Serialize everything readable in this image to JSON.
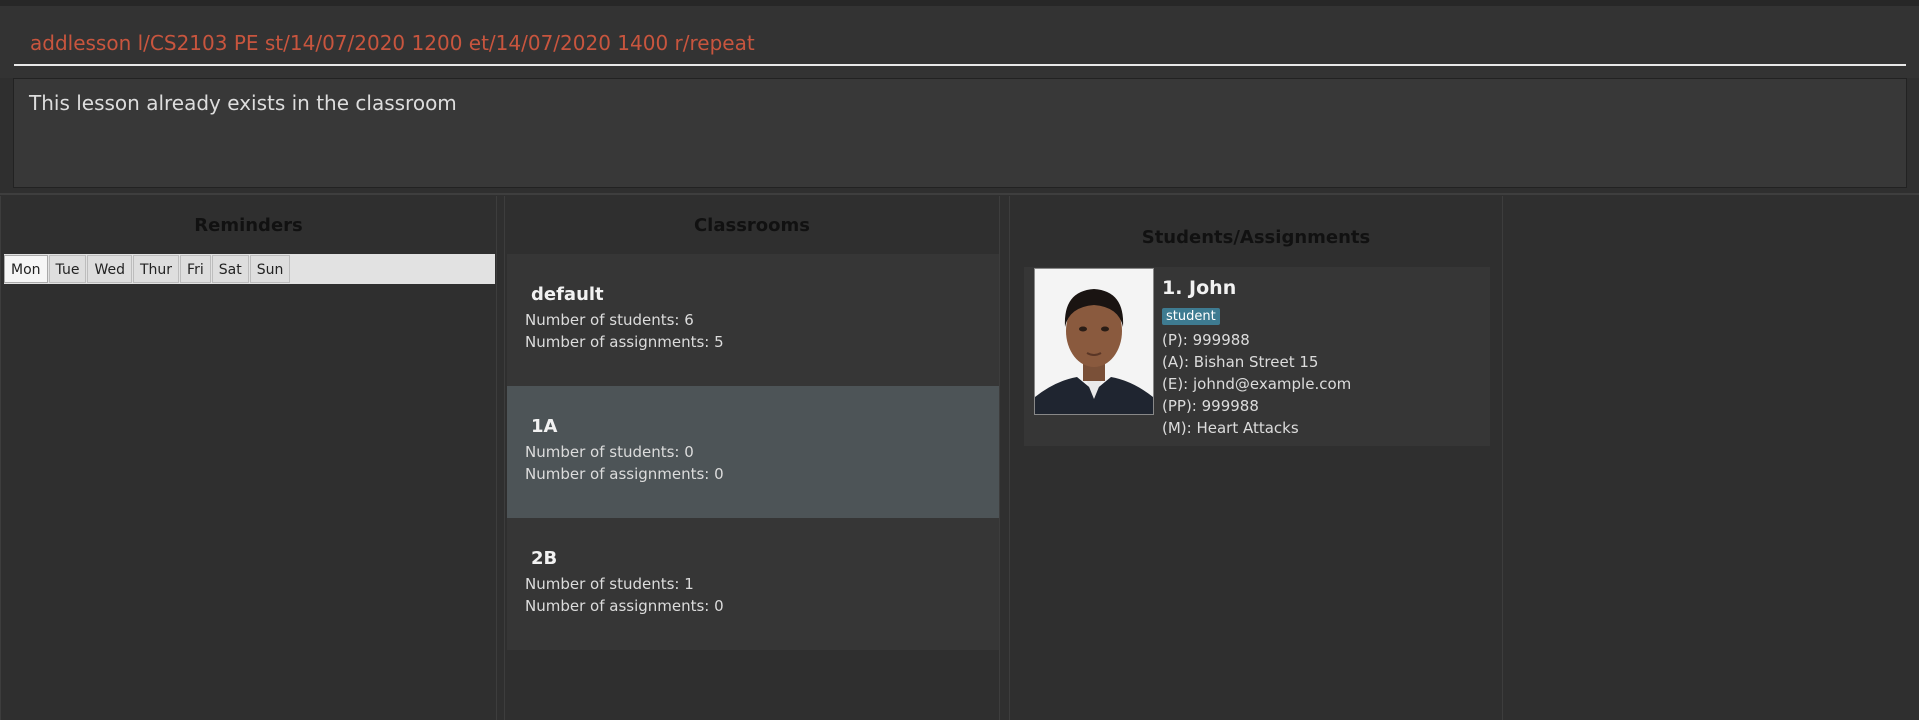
{
  "command": {
    "input_value": "addlesson l/CS2103 PE st/14/07/2020 1200 et/14/07/2020 1400 r/repeat"
  },
  "result": {
    "message": "This lesson already exists in the classroom"
  },
  "reminders": {
    "title": "Reminders",
    "days": [
      "Mon",
      "Tue",
      "Wed",
      "Thur",
      "Fri",
      "Sat",
      "Sun"
    ],
    "active_day": "Mon"
  },
  "classrooms": {
    "title": "Classrooms",
    "items": [
      {
        "name": "default",
        "students_line": "Number of students: 6",
        "assignments_line": "Number of assignments: 5"
      },
      {
        "name": "1A",
        "students_line": "Number of students: 0",
        "assignments_line": "Number of assignments: 0"
      },
      {
        "name": "2B",
        "students_line": "Number of students: 1",
        "assignments_line": "Number of assignments: 0"
      }
    ],
    "selected_index": 1
  },
  "students": {
    "title": "Students/Assignments",
    "items": [
      {
        "index_name": "1.  John",
        "tag": "student",
        "phone": "(P): 999988",
        "address": "(A): Bishan Street 15",
        "email": "(E): johnd@example.com",
        "parent_phone": "(PP): 999988",
        "medical": "(M): Heart Attacks"
      }
    ]
  },
  "colors": {
    "command_text": "#c8553e",
    "tag_bg": "#3e7b91",
    "selected_card": "#4d5457"
  }
}
